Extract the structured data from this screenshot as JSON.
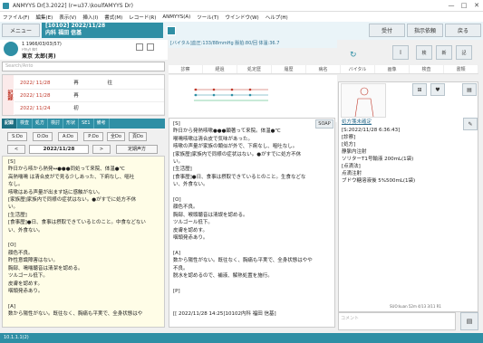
{
  "window": {
    "title": "ANMYYS Dr[3.2022] (r=u37.\\koulfAMYYS Dr)",
    "minimize": "—",
    "maximize": "□",
    "close": "✕"
  },
  "menu": [
    "ファイル(F)",
    "編集(E)",
    "表示(V)",
    "挿入(I)",
    "書式(M)",
    "レコード(R)",
    "ANMYYS(A)",
    "ツール(T)",
    "ウインドウ(W)",
    "ヘルプ(H)"
  ],
  "toolbar": {
    "menu_label": "メニュー",
    "patient_bar_line1": "[10102] 2022/11/28",
    "patient_bar_line2": "内科 福田 信基",
    "uketsuke": "受付",
    "shiji": "指示依頼",
    "modoru": "戻る"
  },
  "patient": {
    "id_dob": "1 1966/03/03(57)",
    "kana": "ﾄｳｷｮｳ ﾀﾛｳ",
    "name": "東京 太郎(男)"
  },
  "vitals_header": "[バイタル]血圧:133/88mmHg 脈拍:80/回 体温:36.7",
  "search_placeholder": "Search/Anto",
  "history": {
    "side_label": "記録",
    "rows": [
      {
        "date": "2022/ 11/28",
        "kind": "再",
        "extra": "往"
      },
      {
        "date": "2022/ 11/28",
        "kind": "再",
        "extra": ""
      },
      {
        "date": "2022/ 11/24",
        "kind": "初",
        "extra": ""
      }
    ]
  },
  "left_tabs": [
    "記録",
    "検査",
    "処方",
    "検討",
    "形状",
    "SE1",
    "備考"
  ],
  "soap_buttons": [
    "S:Do",
    "O:Do",
    "A:Do",
    "P:Do",
    "全Do",
    "頁Do"
  ],
  "date_nav": {
    "prev": "<",
    "date": "2022/11/28",
    "next": ">",
    "teiki": "定期声方"
  },
  "left_text": "[S]\n昨日から咳から熱発↔●●●同処って来院、体温●℃\n高熱喘鳴 は清合皮がで見る少しあった、下痢なし、嘔吐\nなし。\n咳嗽はある声量が出ます話に感触がない。\n[家族歴]家族内で同様の症状はない。●がすでに処方不休\nい。\n[生活歴]\n[食事歴]●日、食事は摂取できているとのこと。中食などない\nい、外食ない。\n\n[O]\n顔色不良。\n昨性意識障害はない。\n胸部、鳴喘聴音は清潔を認める。\nツルゴール低下。\n皮膚を認めす。\n咽頭発赤あり。\n\n[A]\n数から陽性がない。既往なく、胸痛も平実で、全身状態はや",
  "vital_tabs": [
    "診察",
    "経過",
    "処定歴",
    "履歴",
    "病名",
    "バイタル",
    "画像",
    "検査",
    "書類"
  ],
  "mid_text": "[S]\n昨日から発熱咳嗽●●●顕著って来院。体温●℃\n喉鳴咳嗽は清合皮で気味があった。\n咳嗽の声量が家族の類似が外で、下痢なし、嘔吐なし。\n[家族歴]家族内で同様の症状はない。●がすでに処方不休\nい。\n[生活歴]\n[食事歴]●日、食事は摂取できているとのこと。生食などな\nい、外食ない。\n\n[O]\n顔色不良。\n胸部、喉頭聴音は清誤を認める。\nツルゴール低下。\n皮膚を認めす。\n咽頭発赤あり。\n\n[A]\n数から陽性がない。既往なく、胸痛も平実で、全身状態はやや\n不良。\n脱水を認めるので、補液、解熱処置を施行。\n\n[P]\n\n\n[[ 2022/11/28 14:25]10102内科 福田 信基]",
  "soap_badge": "SOAP",
  "right_panel": {
    "title": "処方箋未確定",
    "text": "[S:2022/11/28 6:36:43]\n[診察]\n[処方]\n静脈内注射\nソリターT1号輸液 200mL(1袋)\n[点滴法]\n点滴注射\nブドウ糖溶液後 5%500mL(1袋)",
    "footer": "SUO:kuan 52m 4/13 3/11 R1",
    "comment_placeholder": "コメント"
  },
  "statusbar": "10.1.1.1(2)"
}
